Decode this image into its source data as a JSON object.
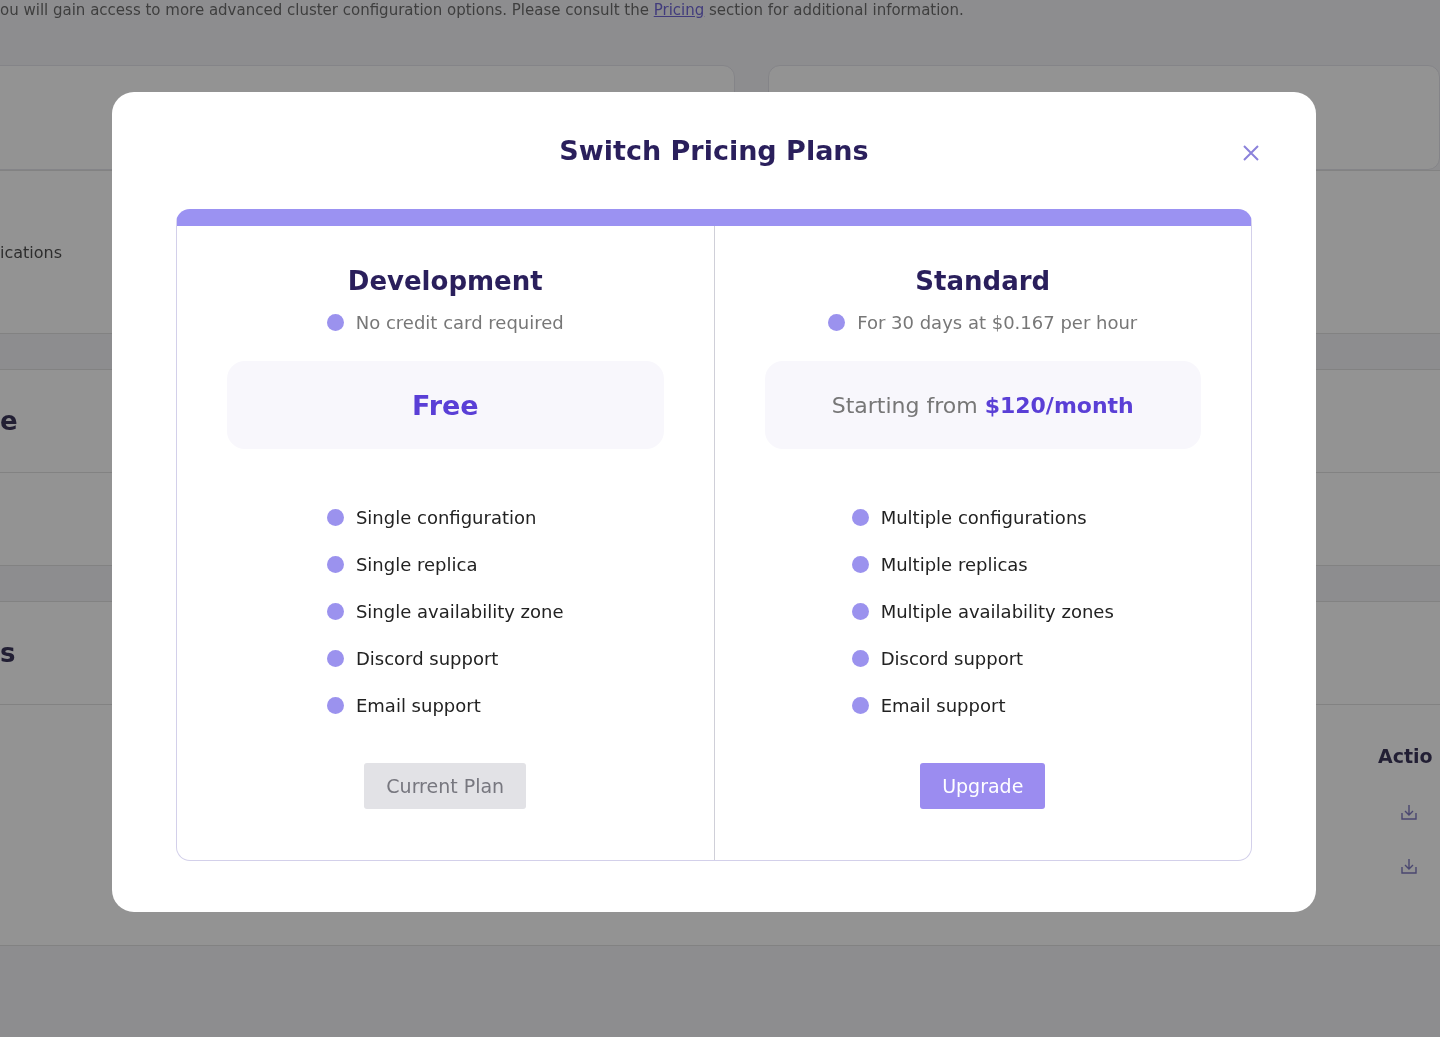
{
  "page": {
    "notice_link": "Pricing",
    "notice_before": "ou will gain access to more advanced cluster configuration options. Please consult the ",
    "notice_after": " section for additional information.",
    "section_text": "ications",
    "section_headings": [
      "e",
      "s"
    ],
    "table_header": "Actio"
  },
  "modal": {
    "title": "Switch Pricing Plans",
    "plans": [
      {
        "name": "Development",
        "note": "No credit card required",
        "price": "Free",
        "kind": "free",
        "features": [
          "Single configuration",
          "Single replica",
          "Single availability zone",
          "Discord support",
          "Email support"
        ],
        "button": {
          "label": "Current Plan",
          "disabled": true
        }
      },
      {
        "name": "Standard",
        "note": "For 30 days at $0.167 per hour",
        "price": "Starting from **$120/month**",
        "kind": "paid",
        "features": [
          "Multiple configurations",
          "Multiple replicas",
          "Multiple availability zones",
          "Discord support",
          "Email support"
        ],
        "button": {
          "label": "Upgrade",
          "disabled": false
        }
      }
    ]
  }
}
